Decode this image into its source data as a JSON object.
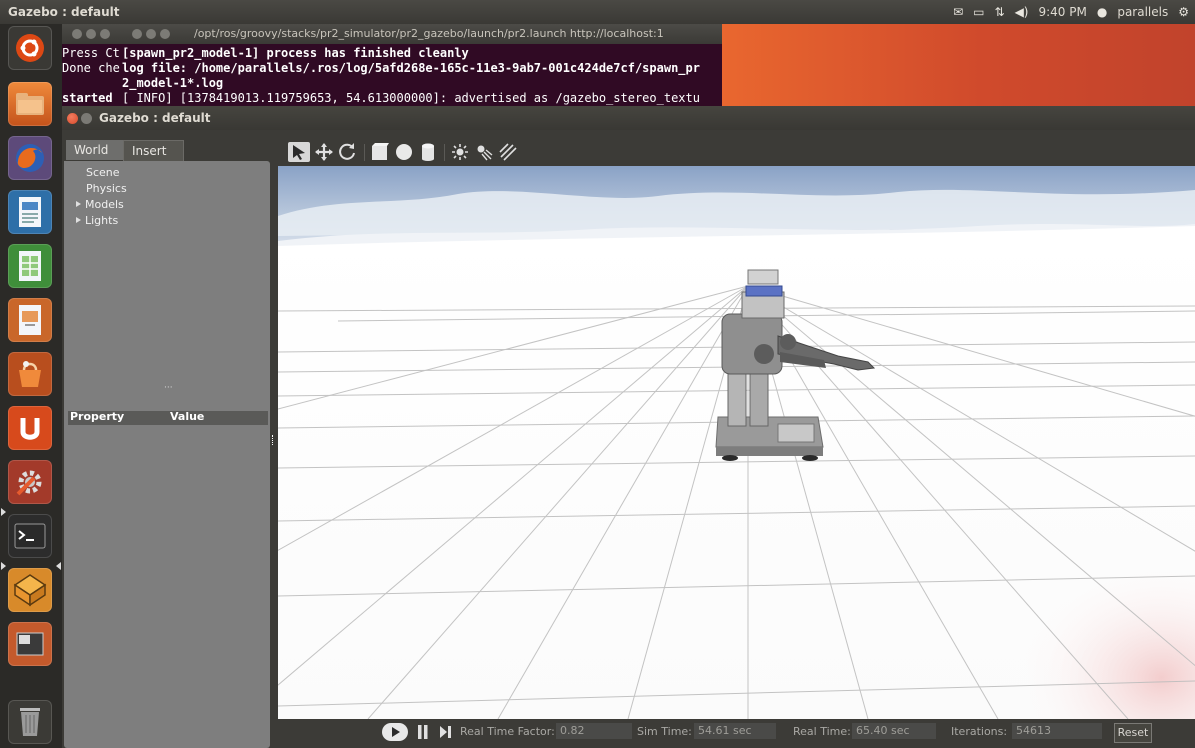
{
  "top_panel": {
    "title": "Gazebo : default",
    "tray_icons": [
      "mail-icon",
      "battery-icon",
      "network-icon",
      "volume-icon"
    ],
    "time": "9:40 PM",
    "user": "parallels"
  },
  "launcher": {
    "items": [
      "ubuntu-logo-icon",
      "files-icon",
      "firefox-icon",
      "writer-icon",
      "calc-icon",
      "impress-icon",
      "software-center-icon",
      "ubuntu-one-icon",
      "settings-icon",
      "terminal-icon",
      "gazebo-icon",
      "workspace-switcher-icon",
      "trash-icon"
    ]
  },
  "terminal": {
    "title": "/opt/ros/groovy/stacks/pr2_simulator/pr2_gazebo/launch/pr2.launch http://localhost:1",
    "lines": [
      "Press Ct",
      "Done che",
      "started "
    ],
    "overlay_lines": [
      "[spawn_pr2_model-1] process has finished cleanly",
      "log file: /home/parallels/.ros/log/5afd268e-165c-11e3-9ab7-001c424de7cf/spawn_pr",
      "2_model-1*.log",
      "[ INFO] [1378419013.119759653, 54.613000000]: advertised as /gazebo_stereo_textu"
    ]
  },
  "gazebo": {
    "title": "Gazebo : default",
    "tabs": [
      "World",
      "Insert"
    ],
    "tree": [
      {
        "label": "Scene",
        "expandable": false
      },
      {
        "label": "Physics",
        "expandable": false
      },
      {
        "label": "Models",
        "expandable": true
      },
      {
        "label": "Lights",
        "expandable": true
      }
    ],
    "property_header": {
      "property": "Property",
      "value": "Value"
    },
    "toolbar_icons": [
      "select-arrow-icon",
      "translate-icon",
      "rotate-icon",
      "box-icon",
      "sphere-icon",
      "cylinder-icon",
      "point-light-icon",
      "spot-light-icon",
      "directional-light-icon"
    ],
    "bottom_bar": {
      "real_time_factor_label": "Real Time Factor:",
      "real_time_factor": "0.82",
      "sim_time_label": "Sim Time:",
      "sim_time": "54.61 sec",
      "real_time_label": "Real Time:",
      "real_time": "65.40 sec",
      "iterations_label": "Iterations:",
      "iterations": "54613",
      "reset_label": "Reset"
    }
  }
}
